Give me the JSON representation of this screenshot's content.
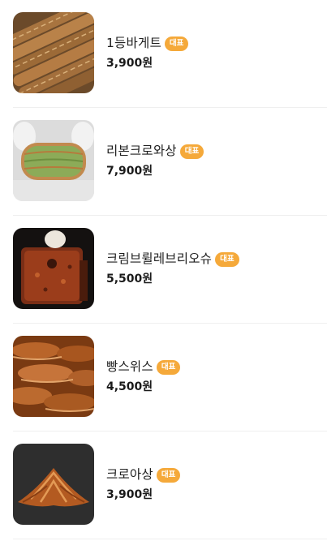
{
  "menu": {
    "items": [
      {
        "name": "1등바게트",
        "badge": "대표",
        "price": "3,900원",
        "image_icon": "baguette-photo"
      },
      {
        "name": "리본크로와상",
        "badge": "대표",
        "price": "7,900원",
        "image_icon": "ribbon-croissant-photo"
      },
      {
        "name": "크림브륄레브리오슈",
        "badge": "대표",
        "price": "5,500원",
        "image_icon": "creme-brulee-brioche-photo"
      },
      {
        "name": "빵스위스",
        "badge": "대표",
        "price": "4,500원",
        "image_icon": "swiss-roll-pastry-photo"
      },
      {
        "name": "크로아상",
        "badge": "대표",
        "price": "3,900원",
        "image_icon": "croissant-photo"
      }
    ]
  },
  "colors": {
    "badge_bg": "#f5a93a",
    "divider": "#efefef"
  }
}
